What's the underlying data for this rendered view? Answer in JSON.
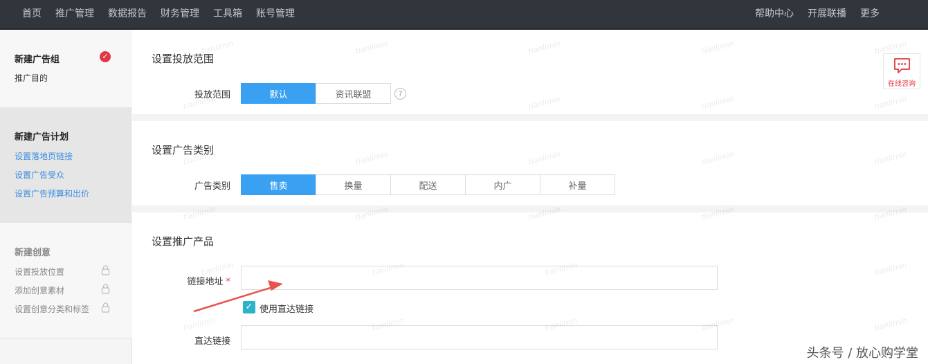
{
  "nav": {
    "left": [
      "首页",
      "推广管理",
      "数据报告",
      "财务管理",
      "工具箱",
      "账号管理"
    ],
    "right": [
      "帮助中心",
      "开展联播",
      "更多"
    ]
  },
  "sidebar": {
    "group1": {
      "title": "新建广告组",
      "items": [
        "推广目的"
      ]
    },
    "group2": {
      "title": "新建广告计划",
      "items": [
        "设置落地页链接",
        "设置广告受众",
        "设置广告预算和出价"
      ]
    },
    "group3": {
      "title": "新建创意",
      "items": [
        "设置投放位置",
        "添加创意素材",
        "设置创意分类和标签"
      ]
    }
  },
  "section1": {
    "title": "设置投放范围",
    "label": "投放范围",
    "options": [
      "默认",
      "资讯联盟"
    ],
    "selected": "默认",
    "help_icon": "question-circle-icon"
  },
  "section2": {
    "title": "设置广告类别",
    "label": "广告类别",
    "options": [
      "售卖",
      "换量",
      "配送",
      "内广",
      "补量"
    ],
    "selected": "售卖"
  },
  "section3": {
    "title": "设置推广产品",
    "link_label": "链接地址",
    "required_mark": "*",
    "link_value": "",
    "checkbox_label": "使用直达链接",
    "checkbox_checked": true,
    "direct_label": "直达链接",
    "direct_value": ""
  },
  "consult": {
    "label": "在线咨询",
    "icon": "chat-bubble-icon"
  },
  "watermark": "tianlimin",
  "footer_mark": "头条号 / 放心购学堂",
  "colors": {
    "accent": "#3aa1f2",
    "nav_bg": "#31363c",
    "danger": "#e23744",
    "link": "#3d8fe0",
    "checkbox": "#2bb3c9"
  }
}
